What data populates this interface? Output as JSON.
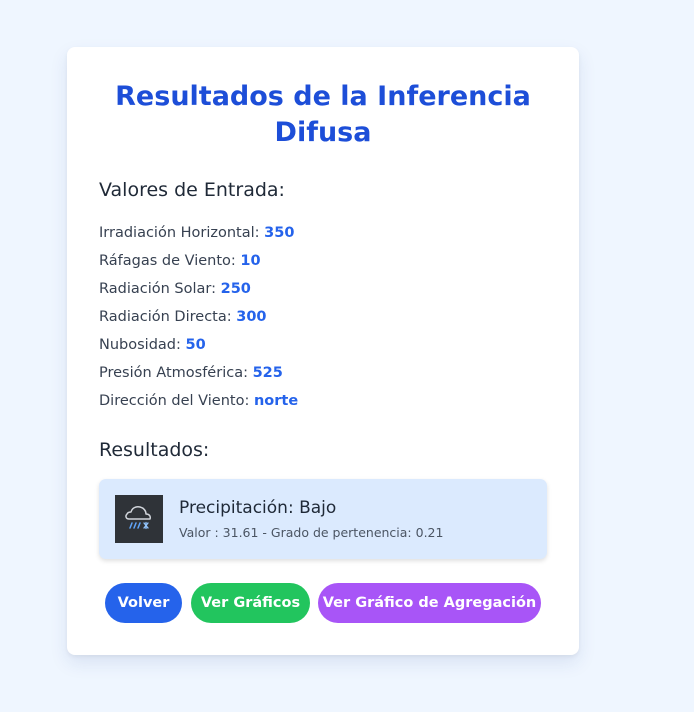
{
  "page": {
    "title": "Resultados de la Inferencia Difusa"
  },
  "inputs": {
    "heading": "Valores de Entrada:",
    "items": [
      {
        "label": "Irradiación Horizontal:",
        "value": "350"
      },
      {
        "label": "Ráfagas de Viento:",
        "value": "10"
      },
      {
        "label": "Radiación Solar:",
        "value": "250"
      },
      {
        "label": "Radiación Directa:",
        "value": "300"
      },
      {
        "label": "Nubosidad:",
        "value": "50"
      },
      {
        "label": "Presión Atmosférica:",
        "value": "525"
      },
      {
        "label": "Dirección del Viento:",
        "value": "norte"
      }
    ]
  },
  "results": {
    "heading": "Resultados:",
    "item": {
      "icon": "cloud-rain-snow-icon",
      "title": "Precipitación: Bajo",
      "detail": "Valor : 31.61 - Grado de pertenencia: 0.21"
    }
  },
  "buttons": {
    "back_label": "Volver",
    "charts_label": "Ver Gráficos",
    "aggregation_label": "Ver Gráfico de Agregación"
  },
  "colors": {
    "page_background": "#eff6ff",
    "title": "#1d4ed8",
    "value": "#2563eb",
    "result_background": "#dbeafe",
    "back_button": "#2563eb",
    "charts_button": "#22c55e",
    "aggregation_button": "#a855f7"
  }
}
